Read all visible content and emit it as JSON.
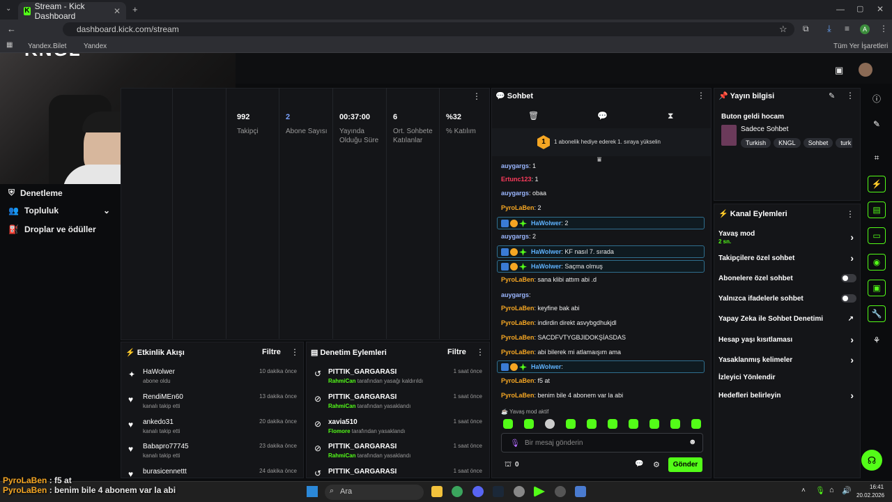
{
  "browser": {
    "tab_title": "Stream - Kick Dashboard",
    "url": "dashboard.kick.com/stream",
    "bookmarks": [
      "Yandex.Bilet",
      "Yandex"
    ],
    "bookmarks_right": "Tüm Yer İşaretleri",
    "profile_initial": "A"
  },
  "brand": {
    "logo": "KNGL"
  },
  "sidebar": {
    "items": [
      {
        "label": "Denetleme",
        "icon": "shield-icon"
      },
      {
        "label": "Topluluk",
        "icon": "people-icon"
      },
      {
        "label": "Droplar ve ödüller",
        "icon": "gift-icon"
      }
    ]
  },
  "stats": [
    {
      "value": "992",
      "label": "Takipçi"
    },
    {
      "value": "2",
      "label": "Abone Sayısı"
    },
    {
      "value": "00:37:00",
      "label": "Yayında Olduğu Süre"
    },
    {
      "value": "6",
      "label": "Ort. Sohbete Katılanlar"
    },
    {
      "value": "%32",
      "label": "% Katılım"
    }
  ],
  "activity": {
    "title": "Etkinlik Akışı",
    "filter": "Filtre",
    "rows": [
      {
        "name": "HaWolwer",
        "sub": "abone oldu",
        "time": "10 dakika önce",
        "icon": "sparkle-icon"
      },
      {
        "name": "RendiMEn60",
        "sub": "kanalı takip etti",
        "time": "13 dakika önce",
        "icon": "heart-icon"
      },
      {
        "name": "ankedo31",
        "sub": "kanalı takip etti",
        "time": "20 dakika önce",
        "icon": "heart-icon"
      },
      {
        "name": "Babapro77745",
        "sub": "kanalı takip etti",
        "time": "23 dakika önce",
        "icon": "heart-icon"
      },
      {
        "name": "burasicennettt",
        "sub": "",
        "time": "24 dakika önce",
        "icon": "heart-icon"
      }
    ]
  },
  "moderation": {
    "title": "Denetim Eylemleri",
    "filter": "Filtre",
    "rows": [
      {
        "name": "PITTIK_GARGARASI",
        "mod": "RahmiCan",
        "sub": "tarafından yasağı kaldırıldı",
        "time": "1 saat önce",
        "icon": "undo-icon"
      },
      {
        "name": "PITTIK_GARGARASI",
        "mod": "RahmiCan",
        "sub": "tarafından yasaklandı",
        "time": "1 saat önce",
        "icon": "ban-icon"
      },
      {
        "name": "xavia510",
        "mod": "Flomore",
        "sub": "tarafından yasaklandı",
        "time": "1 saat önce",
        "icon": "ban-icon"
      },
      {
        "name": "PITTIK_GARGARASI",
        "mod": "RahmiCan",
        "sub": "tarafından yasaklandı",
        "time": "1 saat önce",
        "icon": "ban-icon"
      },
      {
        "name": "PITTIK_GARGARASI",
        "mod": "",
        "sub": "",
        "time": "1 saat önce",
        "icon": "undo-icon"
      }
    ]
  },
  "chat": {
    "title": "Sohbet",
    "gift_banner": "1 abonelik hediye ederek 1. sıraya yükselin",
    "gift_count": "1",
    "slow_mode_notice": "Yavaş mod aktif",
    "input_placeholder": "Bir mesaj gönderin",
    "send_label": "Gönder",
    "points": "0",
    "messages": [
      {
        "user": "auygargs",
        "color": "#9bb7ff",
        "text": ": 1",
        "highlight": false
      },
      {
        "user": "Ertunc123",
        "color": "#ff3b5c",
        "text": ": 1",
        "highlight": false
      },
      {
        "user": "auygargs",
        "color": "#9bb7ff",
        "text": ": obaa",
        "highlight": false
      },
      {
        "user": "PyroLaBen",
        "color": "#f5a623",
        "text": ": 2",
        "highlight": false
      },
      {
        "user": "HaWolwer",
        "color": "#5fb3ff",
        "text": ": 2",
        "highlight": true
      },
      {
        "user": "auygargs",
        "color": "#9bb7ff",
        "text": ": 2",
        "highlight": false
      },
      {
        "user": "HaWolwer",
        "color": "#5fb3ff",
        "text": ": KF nasıl 7. sırada",
        "highlight": true
      },
      {
        "user": "HaWolwer",
        "color": "#5fb3ff",
        "text": ": Saçma olmuş",
        "highlight": true
      },
      {
        "user": "PyroLaBen",
        "color": "#f5a623",
        "text": ": sana klibi attım abi .d",
        "highlight": false
      },
      {
        "user": "auygargs",
        "color": "#9bb7ff",
        "text": ":",
        "highlight": false
      },
      {
        "user": "PyroLaBen",
        "color": "#f5a623",
        "text": ": keyfine bak abi",
        "highlight": false
      },
      {
        "user": "PyroLaBen",
        "color": "#f5a623",
        "text": ": indirdin direkt asvybgdhukjdl",
        "highlight": false
      },
      {
        "user": "PyroLaBen",
        "color": "#f5a623",
        "text": ": SACDFVTYGBJIDOKŞİASDAS",
        "highlight": false
      },
      {
        "user": "PyroLaBen",
        "color": "#f5a623",
        "text": ": abi bilerek mi atlamaışım ama",
        "highlight": false
      },
      {
        "user": "HaWolwer",
        "color": "#5fb3ff",
        "text": ":",
        "highlight": true
      },
      {
        "user": "PyroLaBen",
        "color": "#f5a623",
        "text": ": f5 at",
        "highlight": false
      },
      {
        "user": "PyroLaBen",
        "color": "#f5a623",
        "text": ": benim bile 4 abonem var la abi",
        "highlight": false
      }
    ]
  },
  "stream_info": {
    "title": "Yayın bilgisi",
    "stream_title": "Buton geldi hocam",
    "category": "Sadece Sohbet",
    "tags": [
      "Turkish",
      "KNGL",
      "Sohbet",
      "turk"
    ]
  },
  "channel_actions": {
    "title": "Kanal Eylemleri",
    "rows": [
      {
        "label": "Yavaş mod",
        "sub": "2 sn.",
        "control": "chevron"
      },
      {
        "label": "Takipçilere özel sohbet",
        "sub": "",
        "control": "chevron"
      },
      {
        "label": "Abonelere özel sohbet",
        "sub": "",
        "control": "toggle"
      },
      {
        "label": "Yalnızca ifadelerle sohbet",
        "sub": "",
        "control": "toggle"
      },
      {
        "label": "Yapay Zeka ile Sohbet Denetimi",
        "sub": "",
        "control": "external"
      },
      {
        "label": "Hesap yaşı kısıtlaması",
        "sub": "",
        "control": "chevron"
      },
      {
        "label": "Yasaklanmış kelimeler",
        "sub": "",
        "control": "chevron"
      },
      {
        "label": "İzleyici Yönlendir",
        "sub": "",
        "control": "none"
      },
      {
        "label": "Hedefleri belirleyin",
        "sub": "",
        "control": "chevron"
      }
    ]
  },
  "overlay_chat": [
    {
      "user": "PyroLaBen",
      "text": " : f5 at"
    },
    {
      "user": "PyroLaBen",
      "text": " : benim bile 4 abonem var la abi"
    }
  ],
  "taskbar": {
    "search_placeholder": "Ara",
    "time": "16:41",
    "date": "20.02.2026"
  },
  "colors": {
    "accent": "#53fc18",
    "panel": "#141518"
  }
}
